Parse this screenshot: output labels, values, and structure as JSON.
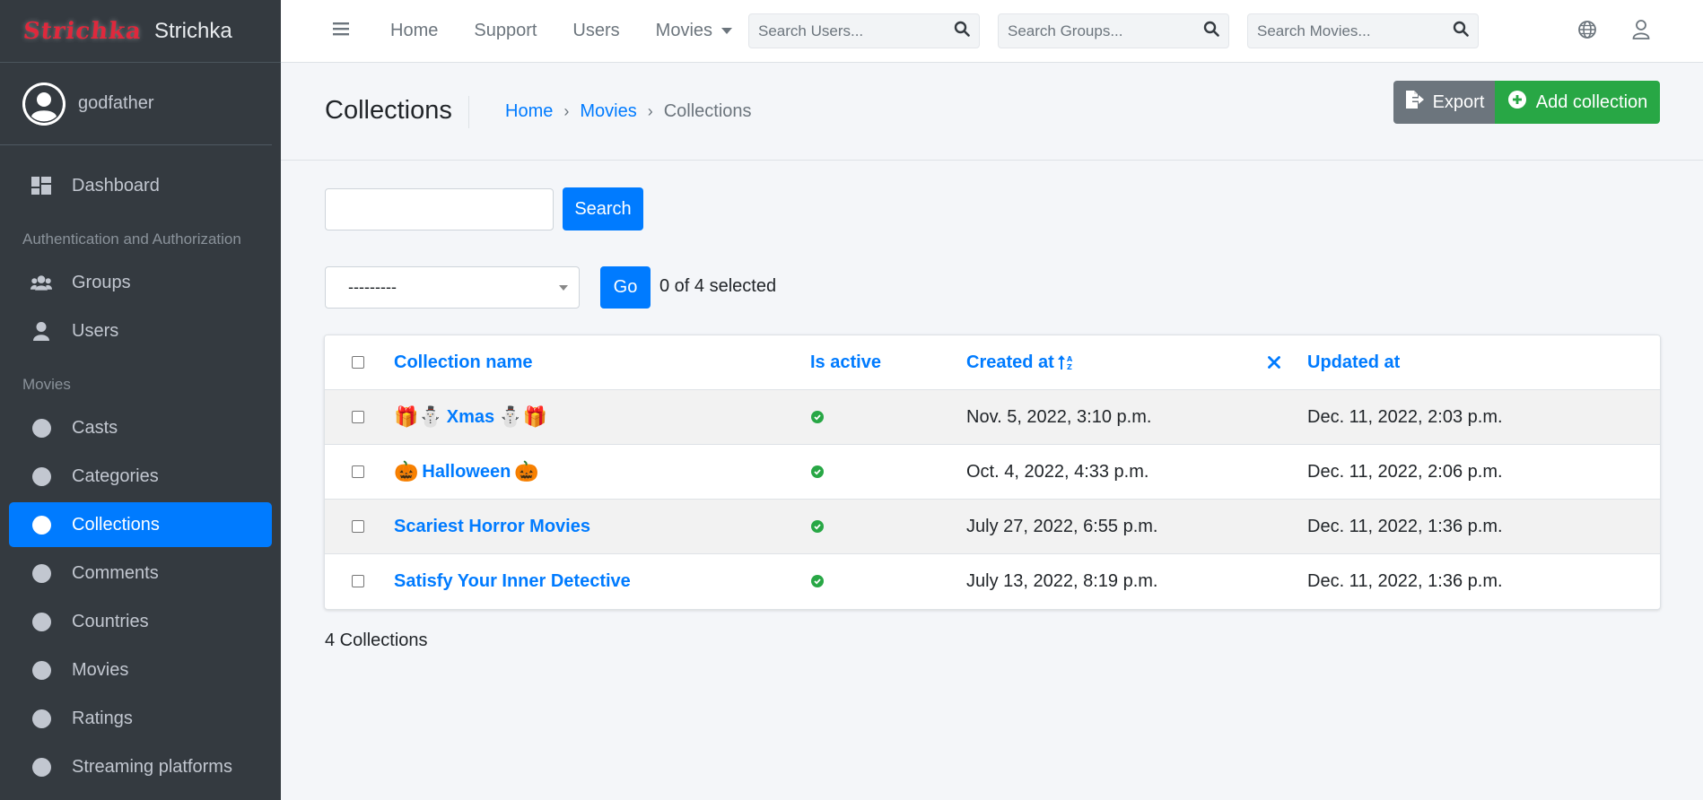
{
  "brand": {
    "logo_text": "Strichka",
    "name": "Strichka"
  },
  "user": {
    "name": "godfather"
  },
  "sidebar": {
    "dashboard": "Dashboard",
    "auth_header": "Authentication and Authorization",
    "groups": "Groups",
    "users": "Users",
    "movies_header": "Movies",
    "items": [
      {
        "label": "Casts"
      },
      {
        "label": "Categories"
      },
      {
        "label": "Collections",
        "active": true
      },
      {
        "label": "Comments"
      },
      {
        "label": "Countries"
      },
      {
        "label": "Movies"
      },
      {
        "label": "Ratings"
      },
      {
        "label": "Streaming platforms"
      }
    ]
  },
  "topnav": {
    "home": "Home",
    "support": "Support",
    "users": "Users",
    "movies": "Movies",
    "search_users_placeholder": "Search Users...",
    "search_groups_placeholder": "Search Groups...",
    "search_movies_placeholder": "Search Movies..."
  },
  "header": {
    "title": "Collections",
    "breadcrumb": {
      "home": "Home",
      "movies": "Movies",
      "current": "Collections"
    },
    "export_label": "Export",
    "add_label": "Add collection"
  },
  "search": {
    "button_label": "Search",
    "value": ""
  },
  "actions": {
    "select_value": "---------",
    "go_label": "Go",
    "selected_text": "0 of 4 selected"
  },
  "table": {
    "columns": {
      "name": "Collection name",
      "active": "Is active",
      "created": "Created at",
      "updated": "Updated at"
    },
    "rows": [
      {
        "prefix": "🎁⛄",
        "name": "Xmas",
        "suffix": "⛄🎁",
        "active": true,
        "created": "Nov. 5, 2022, 3:10 p.m.",
        "updated": "Dec. 11, 2022, 2:03 p.m."
      },
      {
        "prefix": "🎃",
        "name": "Halloween",
        "suffix": "🎃",
        "active": true,
        "created": "Oct. 4, 2022, 4:33 p.m.",
        "updated": "Dec. 11, 2022, 2:06 p.m."
      },
      {
        "prefix": "",
        "name": "Scariest Horror Movies",
        "suffix": "",
        "active": true,
        "created": "July 27, 2022, 6:55 p.m.",
        "updated": "Dec. 11, 2022, 1:36 p.m."
      },
      {
        "prefix": "",
        "name": "Satisfy Your Inner Detective",
        "suffix": "",
        "active": true,
        "created": "July 13, 2022, 8:19 p.m.",
        "updated": "Dec. 11, 2022, 1:36 p.m."
      }
    ]
  },
  "footer": {
    "count_text": "4 Collections"
  },
  "colors": {
    "primary": "#007bff",
    "success": "#28a745",
    "sidebar_bg": "#343a40",
    "secondary": "#6c757d"
  }
}
